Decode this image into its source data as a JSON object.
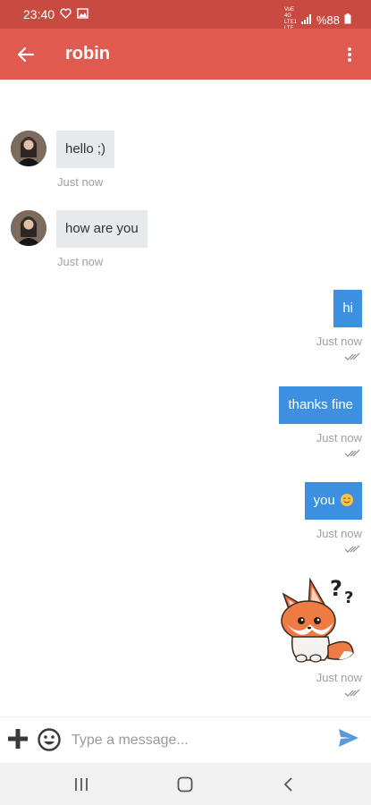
{
  "status_bar": {
    "time": "23:40",
    "net_top": "VoE 4G",
    "net_bottom": "LTE1 LTE",
    "battery": "%88"
  },
  "header": {
    "title": "robin"
  },
  "messages": [
    {
      "direction": "incoming",
      "text": "hello ;)",
      "time": "Just now"
    },
    {
      "direction": "incoming",
      "text": "how are you",
      "time": "Just now"
    },
    {
      "direction": "outgoing",
      "text": "hi",
      "time": "Just now"
    },
    {
      "direction": "outgoing",
      "text": "thanks fine",
      "time": "Just now"
    },
    {
      "direction": "outgoing",
      "text": "you",
      "time": "Just now",
      "emoji": "smiling-face"
    },
    {
      "direction": "outgoing",
      "type": "sticker",
      "sticker": "fox-question-marks",
      "time": "Just now"
    }
  ],
  "composer": {
    "placeholder": "Type a message..."
  },
  "icons": {
    "back": "arrow-left-icon",
    "menu": "kebab-menu-icon",
    "attach": "plus-icon",
    "emoji": "emoji-icon",
    "send": "send-icon",
    "read_receipt": "double-check-icon"
  },
  "colors": {
    "status_bar": "#c94a40",
    "app_bar": "#e05a4f",
    "incoming_bubble": "#e6eaed",
    "outgoing_bubble": "#3d8fe0",
    "send_icon": "#5b9ad8"
  }
}
